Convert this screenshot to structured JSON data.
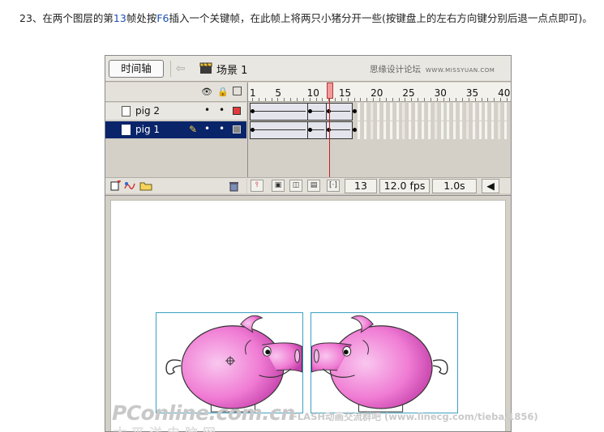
{
  "instruction": {
    "part1": "23、在两个图层的第",
    "frame_num": "13",
    "part2": "帧处按",
    "key": "F6",
    "part3": "插入一个关键帧，在此帧上将两只小猪分开一些(按键盘上的左右方向键分别后退一点点即可)。"
  },
  "topbar": {
    "timeline_button": "时间轴",
    "back_arrow": "⇦",
    "scene_label": "场景 1",
    "brand_cn": "思缘设计论坛",
    "brand_en": "WWW.MISSYUAN.COM"
  },
  "layer_header": {
    "eye_icon": "👁",
    "lock_icon": "🔒",
    "outline_icon": "□"
  },
  "layers": [
    {
      "name": "pig 2",
      "active": false,
      "color": "#e23b3b"
    },
    {
      "name": "pig 1",
      "active": true,
      "color": "#888888"
    }
  ],
  "ruler": {
    "labels": [
      "1",
      "5",
      "10",
      "15",
      "20",
      "25",
      "30",
      "35",
      "40"
    ]
  },
  "controls": {
    "current_frame": "13",
    "fps": "12.0 fps",
    "elapsed": "1.0s"
  },
  "watermarks": {
    "left": "PConline.com.cn",
    "right": "FLASH动画交流群吧 (www.linecg.com/tieba/1856)",
    "sub": "太平洋电脑网"
  },
  "colors": {
    "active_layer": "#0a246a",
    "playhead": "#f49a9a",
    "pig_pink": "#f07cd4",
    "stage_box": "#3ba0c3"
  }
}
